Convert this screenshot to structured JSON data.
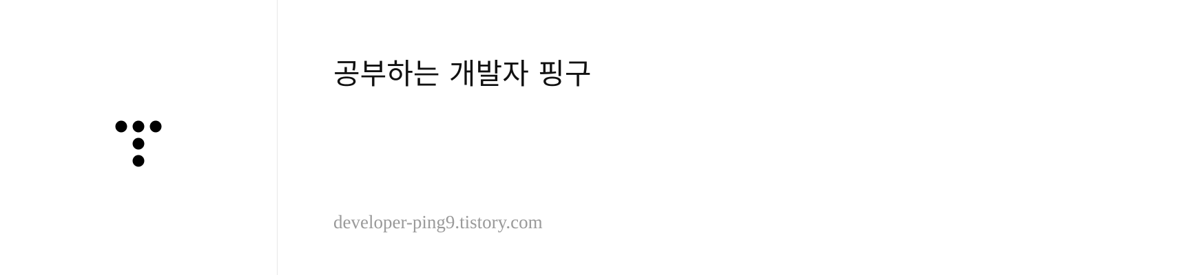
{
  "card": {
    "title": "공부하는 개발자 핑구",
    "url": "developer-ping9.tistory.com"
  },
  "logo": {
    "icon": "tistory-logo-icon",
    "color": "#000000"
  },
  "colors": {
    "background": "#ffffff",
    "title": "#111111",
    "url": "#9a9a9a",
    "divider": "#e8e8e8"
  }
}
